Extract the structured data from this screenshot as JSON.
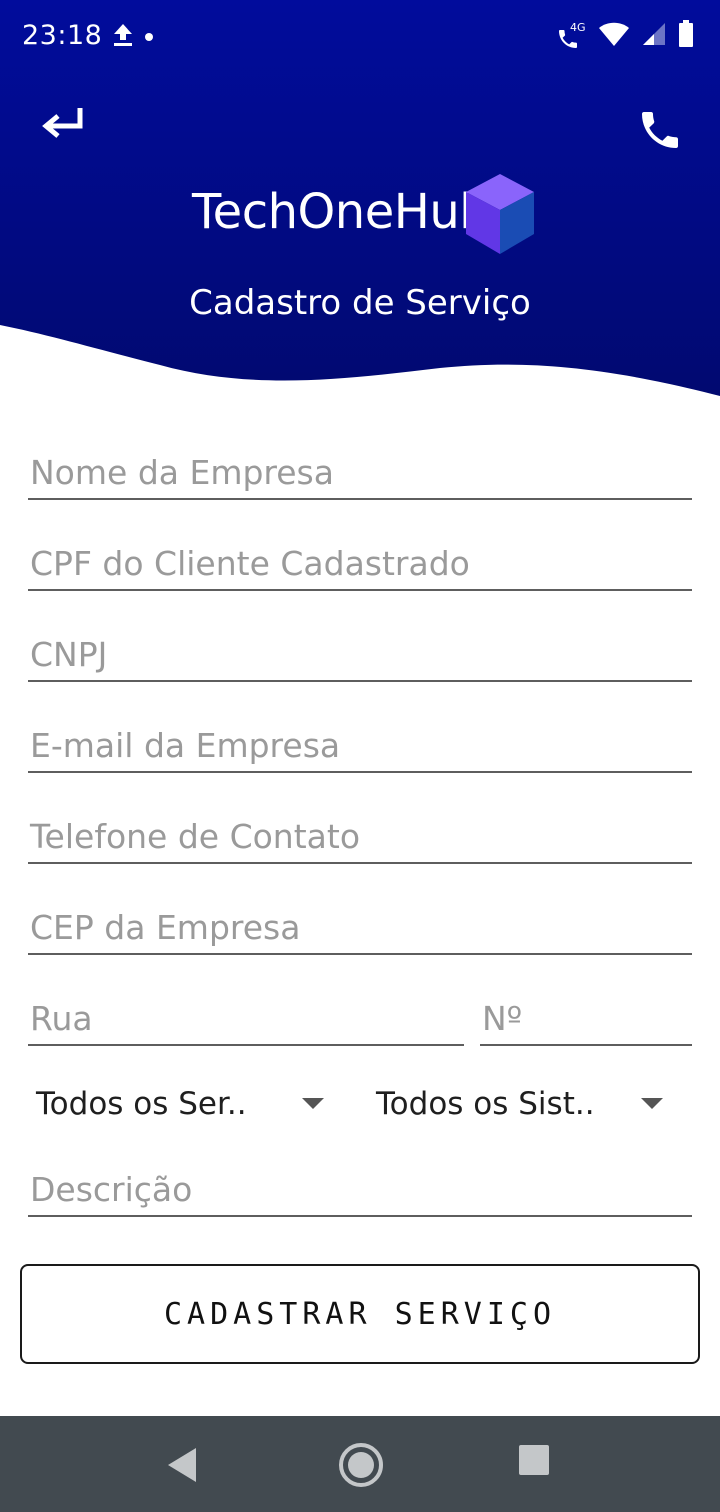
{
  "status_bar": {
    "time": "23:18",
    "network_label": "4G",
    "icons": [
      "upload-icon",
      "dot-icon",
      "call-4g-icon",
      "wifi-icon",
      "signal-icon",
      "battery-icon"
    ]
  },
  "header": {
    "app_name": "TechOneHub",
    "screen_title": "Cadastro de Serviço",
    "back_icon": "back-arrow-icon",
    "call_icon": "phone-icon",
    "background_top_color": "#010c9a",
    "background_bottom_color": "#010a72",
    "logo_colors": [
      "#7a55f5",
      "#5a33e0",
      "#1548b0"
    ]
  },
  "form": {
    "company_name_placeholder": "Nome da Empresa",
    "client_cpf_placeholder": "CPF do Cliente Cadastrado",
    "cnpj_placeholder": "CNPJ",
    "company_email_placeholder": "E-mail da Empresa",
    "contact_phone_placeholder": "Telefone de Contato",
    "company_cep_placeholder": "CEP da Empresa",
    "street_placeholder": "Rua",
    "number_placeholder": "Nº",
    "service_select_value": "Todos os Ser..",
    "system_select_value": "Todos os Sist..",
    "description_placeholder": "Descrição",
    "submit_label": "CADASTRAR SERVIÇO"
  },
  "nav_bar": {
    "icons": [
      "back-triangle-icon",
      "home-circle-icon",
      "recents-square-icon"
    ],
    "background_color": "#424a50"
  }
}
